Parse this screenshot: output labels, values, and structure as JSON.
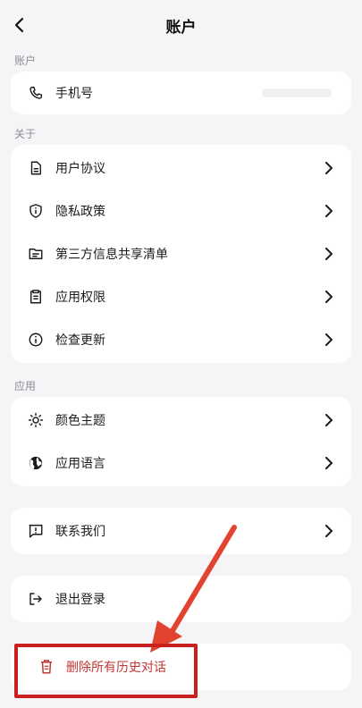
{
  "header": {
    "title": "账户"
  },
  "sections": {
    "account": {
      "label": "账户",
      "phone_label": "手机号"
    },
    "about": {
      "label": "关于",
      "items": [
        "用户协议",
        "隐私政策",
        "第三方信息共享清单",
        "应用权限",
        "检查更新"
      ]
    },
    "app": {
      "label": "应用",
      "items": [
        "颜色主题",
        "应用语言"
      ]
    },
    "contact": {
      "label": "联系我们"
    },
    "logout": {
      "label": "退出登录"
    },
    "delete": {
      "label": "删除所有历史对话"
    }
  },
  "colors": {
    "background": "#f5f5f7",
    "card": "#ffffff",
    "danger": "#c33636",
    "annotation": "#c9201e"
  },
  "icons": {
    "back": "chevron-left-icon",
    "phone": "phone-icon",
    "agreement": "document-icon",
    "privacy": "shield-info-icon",
    "share_list": "folder-list-icon",
    "permissions": "clipboard-icon",
    "update": "info-circle-icon",
    "theme": "sun-icon",
    "language": "globe-icon",
    "contact": "message-alert-icon",
    "logout": "logout-icon",
    "delete": "trash-icon"
  }
}
